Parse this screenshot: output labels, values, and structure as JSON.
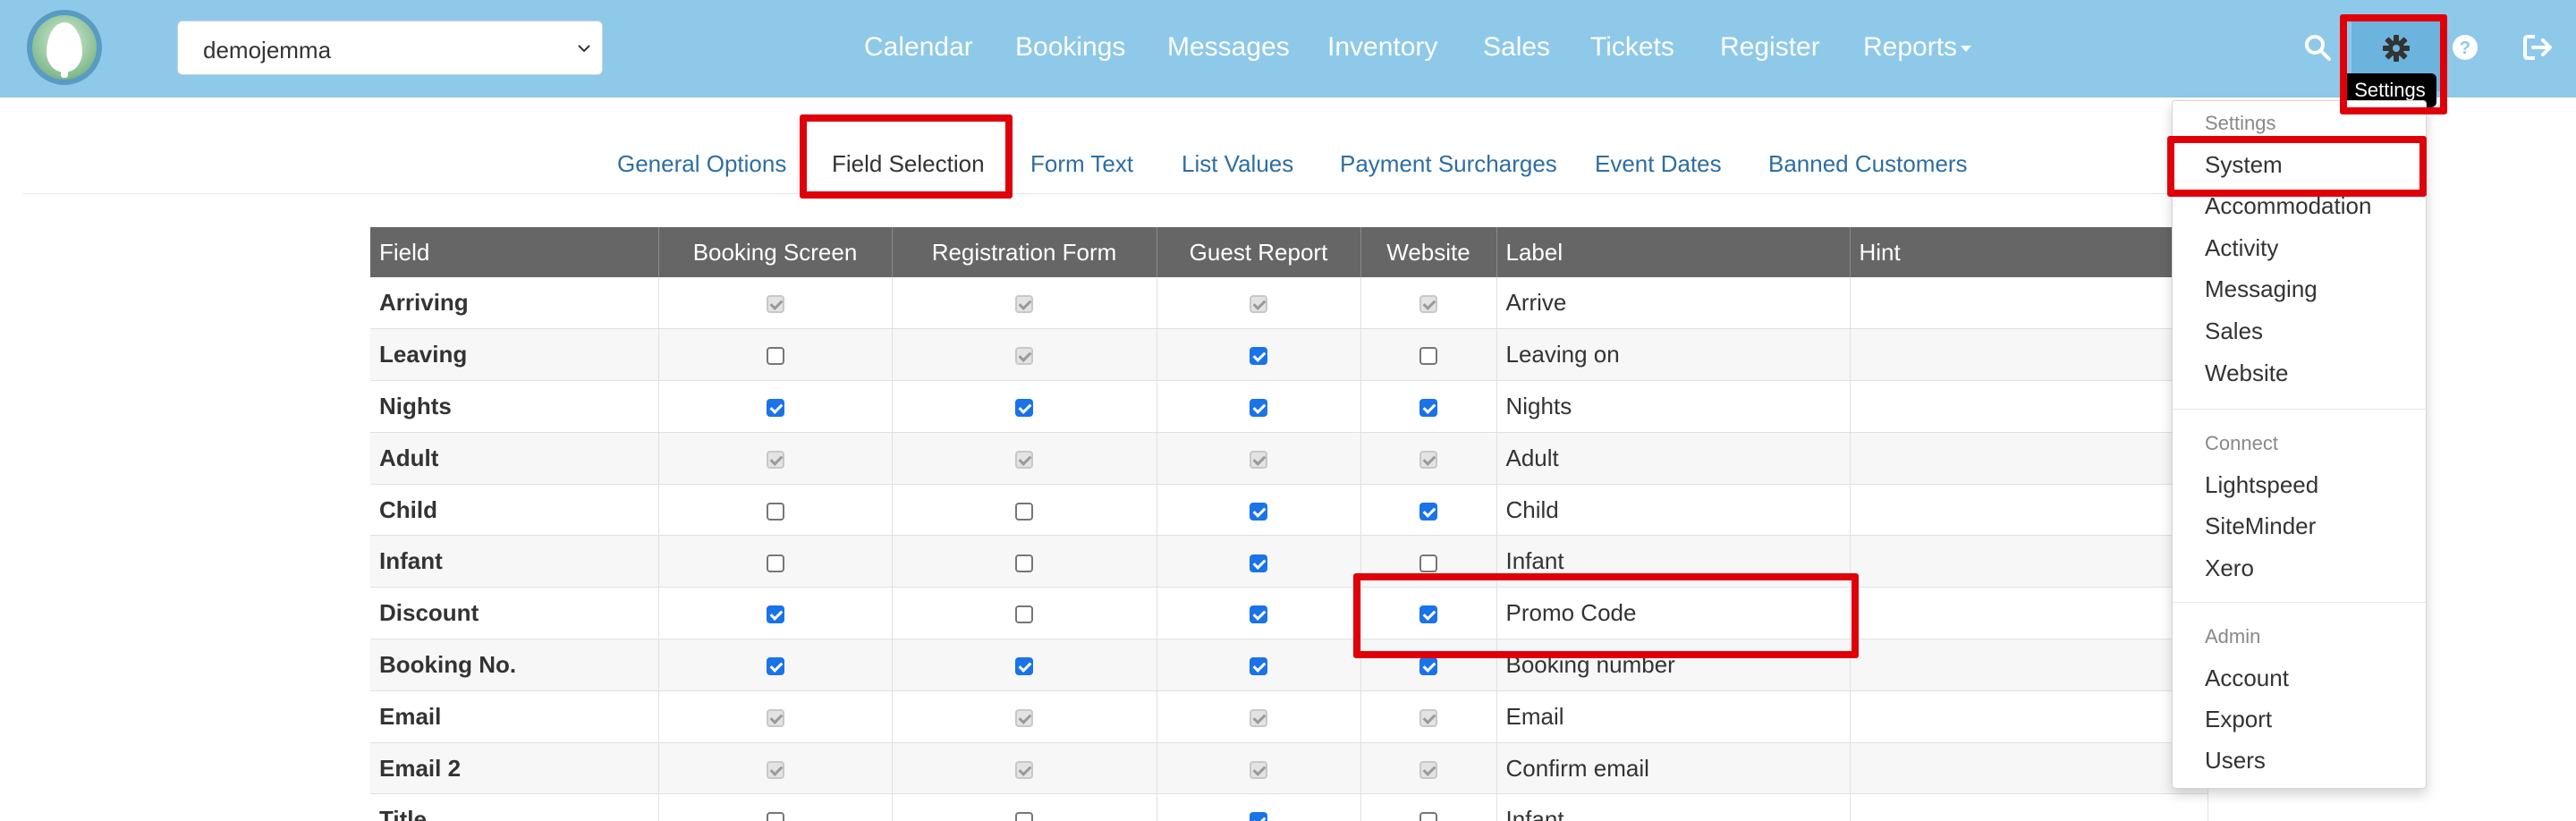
{
  "navbar": {
    "site_selector": "demojemma",
    "items": [
      {
        "label": "Calendar"
      },
      {
        "label": "Bookings"
      },
      {
        "label": "Messages"
      },
      {
        "label": "Inventory"
      },
      {
        "label": "Sales"
      },
      {
        "label": "Tickets"
      },
      {
        "label": "Register"
      },
      {
        "label": "Reports"
      }
    ],
    "settings_tooltip": "Settings",
    "icons": [
      "search-icon",
      "gear-icon",
      "help-icon",
      "logout-icon"
    ]
  },
  "subtabs": [
    {
      "label": "General Options"
    },
    {
      "label": "Field Selection"
    },
    {
      "label": "Form Text"
    },
    {
      "label": "List Values"
    },
    {
      "label": "Payment Surcharges"
    },
    {
      "label": "Event Dates"
    },
    {
      "label": "Banned Customers"
    }
  ],
  "table": {
    "headers": [
      "Field",
      "Booking Screen",
      "Registration Form",
      "Guest Report",
      "Website",
      "Label",
      "Hint"
    ],
    "rows": [
      {
        "field": "Arriving",
        "booking": "disabled",
        "registration": "disabled",
        "guest": "disabled",
        "website": "disabled",
        "label": "Arrive"
      },
      {
        "field": "Leaving",
        "booking": "off",
        "registration": "disabled",
        "guest": "on",
        "website": "off",
        "label": "Leaving on"
      },
      {
        "field": "Nights",
        "booking": "on",
        "registration": "on",
        "guest": "on",
        "website": "on",
        "label": "Nights"
      },
      {
        "field": "Adult",
        "booking": "disabled",
        "registration": "disabled",
        "guest": "disabled",
        "website": "disabled",
        "label": "Adult"
      },
      {
        "field": "Child",
        "booking": "off",
        "registration": "off",
        "guest": "on",
        "website": "on",
        "label": "Child"
      },
      {
        "field": "Infant",
        "booking": "off",
        "registration": "off",
        "guest": "on",
        "website": "off",
        "label": "Infant"
      },
      {
        "field": "Discount",
        "booking": "on",
        "registration": "off",
        "guest": "on",
        "website": "on",
        "label": "Promo Code"
      },
      {
        "field": "Booking No.",
        "booking": "on",
        "registration": "on",
        "guest": "on",
        "website": "on",
        "label": "Booking number"
      },
      {
        "field": "Email",
        "booking": "disabled",
        "registration": "disabled",
        "guest": "disabled",
        "website": "disabled",
        "label": "Email"
      },
      {
        "field": "Email 2",
        "booking": "disabled",
        "registration": "disabled",
        "guest": "disabled",
        "website": "disabled",
        "label": "Confirm email"
      },
      {
        "field": "Title",
        "booking": "off",
        "registration": "off",
        "guest": "on",
        "website": "off",
        "label": "Infant"
      }
    ]
  },
  "settings_menu": {
    "sections": [
      {
        "header": "Settings",
        "items": [
          "System",
          "Accommodation",
          "Activity",
          "Messaging",
          "Sales",
          "Website"
        ]
      },
      {
        "header": "Connect",
        "items": [
          "Lightspeed",
          "SiteMinder",
          "Xero"
        ]
      },
      {
        "header": "Admin",
        "items": [
          "Account",
          "Export",
          "Users"
        ]
      }
    ]
  },
  "colors": {
    "navbar": "#8ec9e9",
    "link": "#2d6ea2",
    "table_header": "#666666",
    "highlight": "#e0000a"
  }
}
